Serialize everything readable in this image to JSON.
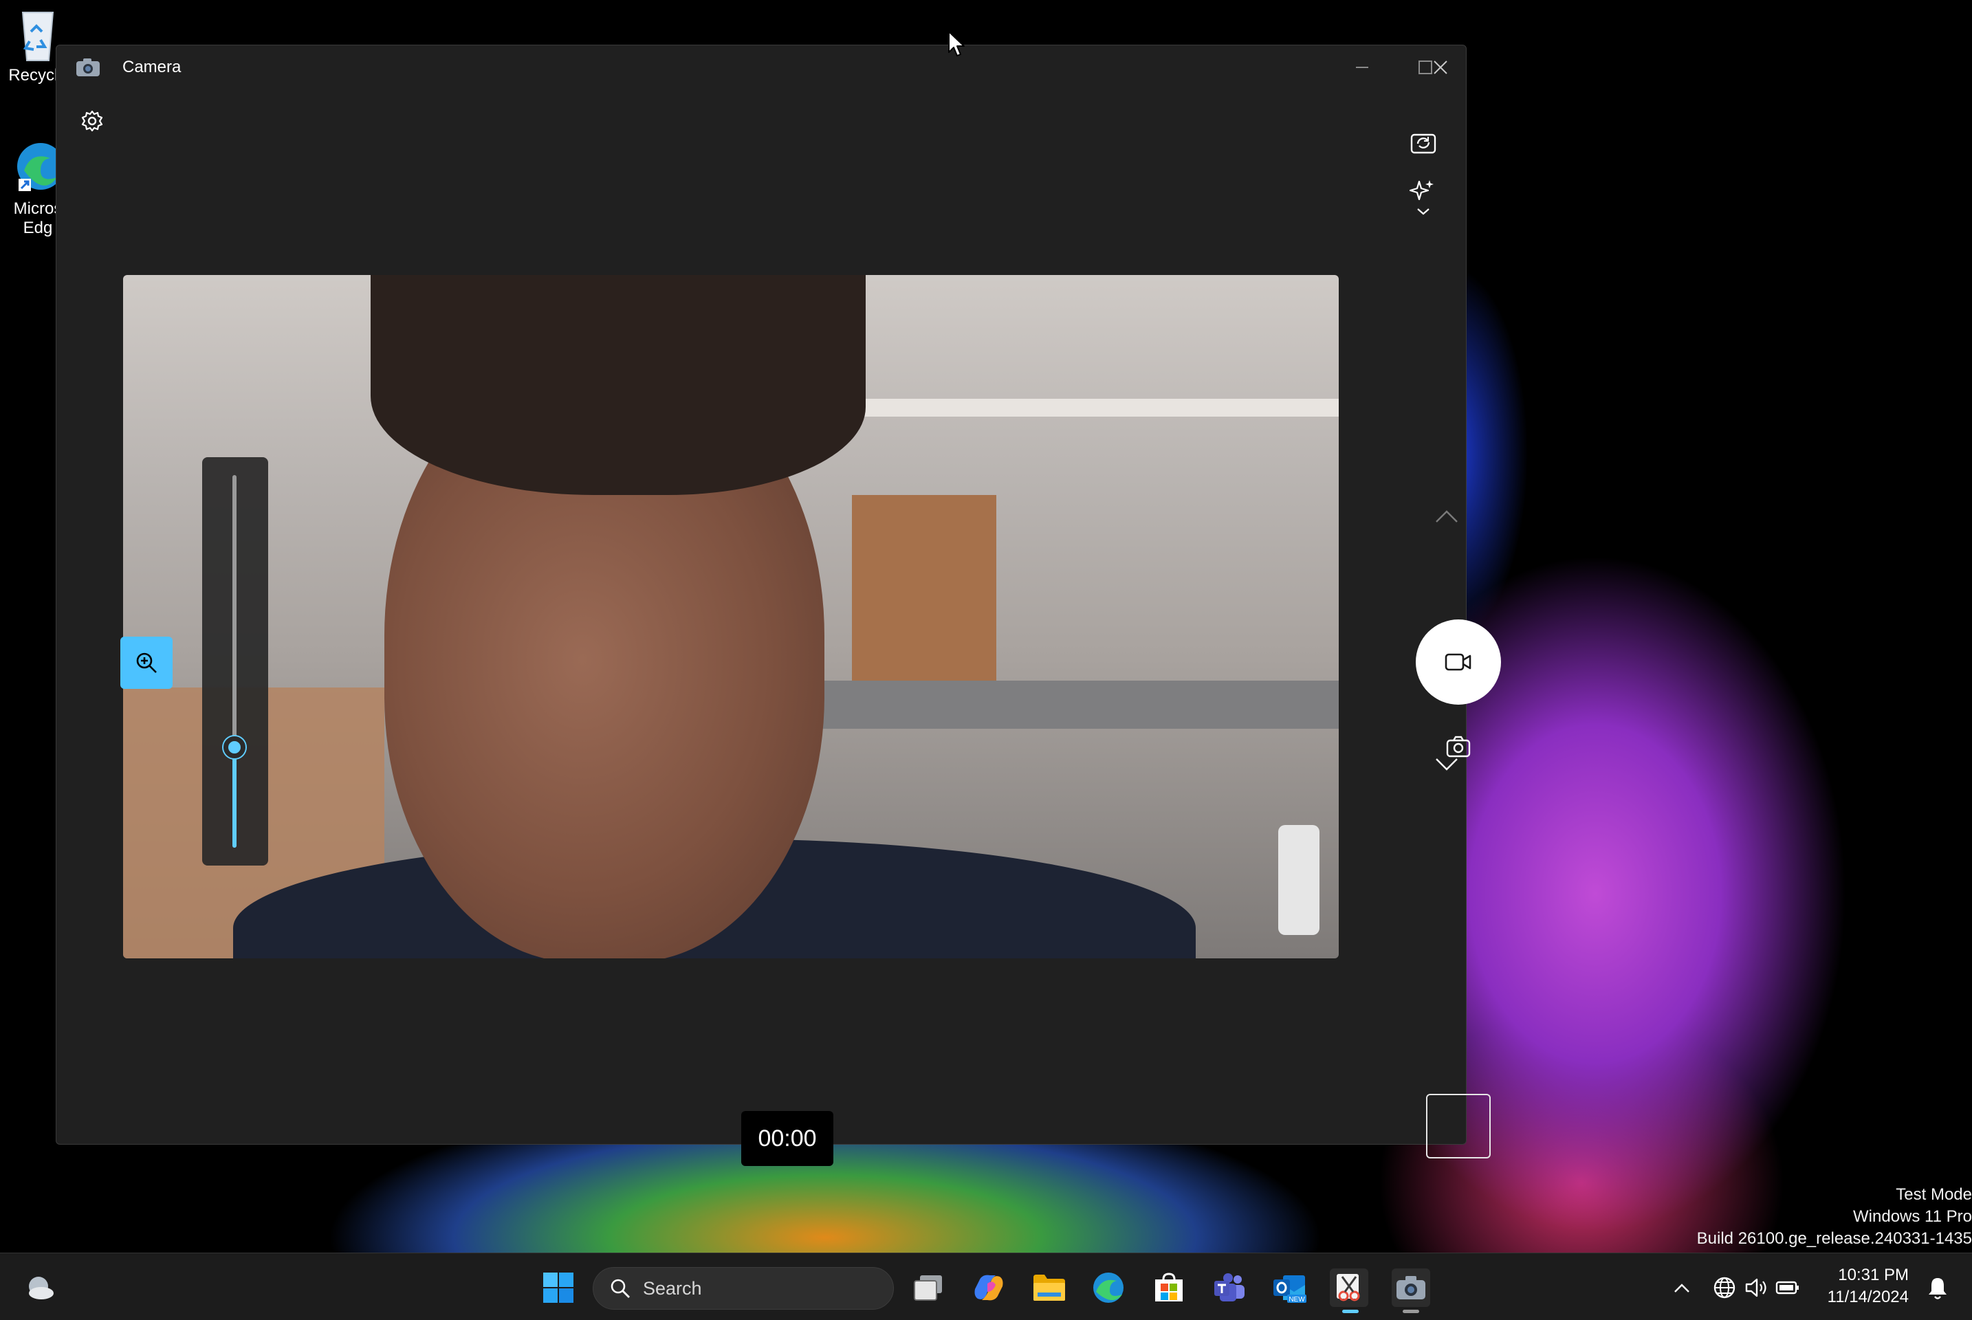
{
  "desktop": {
    "icons": [
      {
        "label": "Recycle",
        "icon": "recycle-bin-icon"
      },
      {
        "label": "Micros\nEdg",
        "icon": "edge-shortcut-icon"
      }
    ],
    "watermark": {
      "line1": "Test Mode",
      "line2": "Windows 11 Pro",
      "line3": "Build 26100.ge_release.240331-1435"
    }
  },
  "window": {
    "title": "Camera",
    "app_icon": "camera-app-icon",
    "controls": [
      "minimize",
      "maximize",
      "close"
    ]
  },
  "camera": {
    "settings_icon": "gear-icon",
    "switch_camera_icon": "switch-camera-icon",
    "effects_icon": "sparkle-effects-icon",
    "zoom_level": 0.27,
    "mode": "video",
    "timer": "00:00",
    "accent": "#60cdff"
  },
  "taskbar": {
    "search_placeholder": "Search",
    "apps": [
      "widgets-weather",
      "start",
      "search",
      "task-view",
      "copilot",
      "file-explorer",
      "edge",
      "microsoft-store",
      "teams",
      "outlook-new",
      "snipping-tool",
      "camera"
    ],
    "tray": {
      "time": "10:31 PM",
      "date": "11/14/2024"
    }
  }
}
